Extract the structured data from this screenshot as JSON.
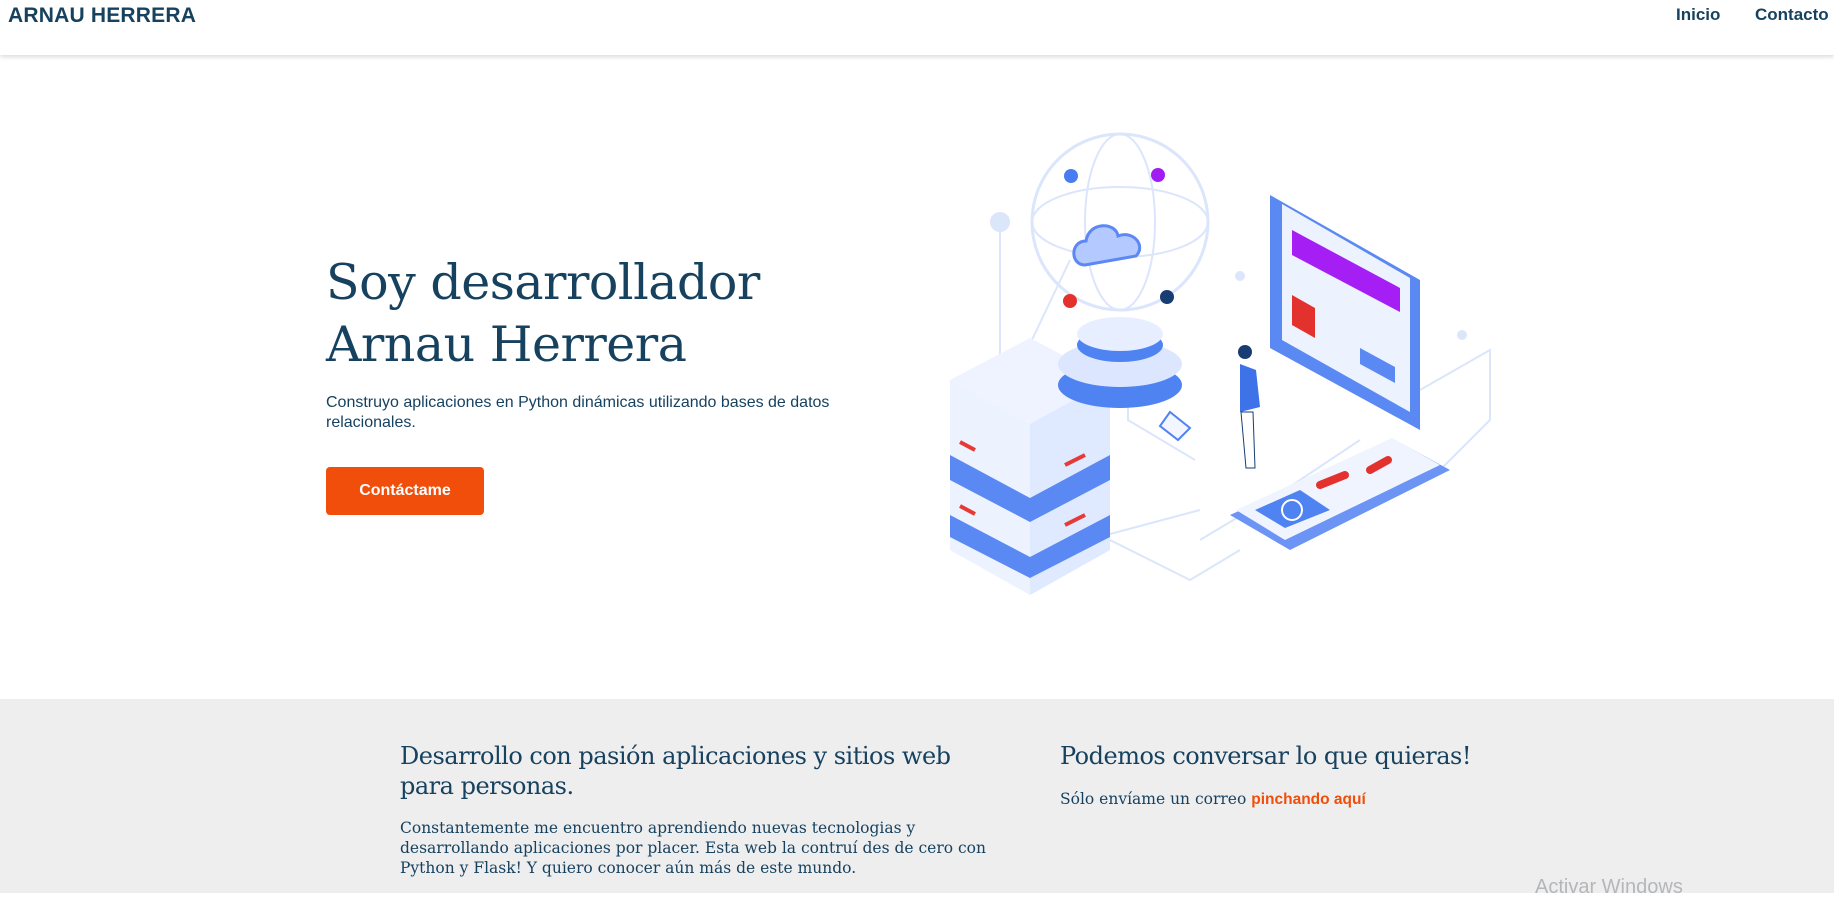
{
  "nav": {
    "brand": "ARNAU HERRERA",
    "links": [
      "Inicio",
      "Contacto"
    ]
  },
  "hero": {
    "title_line1": "Soy desarrollador",
    "title_line2": "Arnau Herrera",
    "text": "Construyo aplicaciones en Python dinámicas utilizando bases de datos relacionales.",
    "cta_label": "Contáctame"
  },
  "features": {
    "left": {
      "title": "Desarrollo con pasión aplicaciones y sitios web para personas.",
      "text": "Constantemente me encuentro aprendiendo nuevas tecnologias y desarrollando aplicaciones por placer. Esta web la contruí des de cero con Python y Flask! Y quiero conocer aún más de este mundo."
    },
    "right": {
      "title": "Podemos conversar lo que quieras!",
      "text_prefix": "Sólo envíame un correo",
      "link_label": "pinchando aquí"
    }
  },
  "overlay": {
    "watermark": "Activar Windows"
  },
  "colors": {
    "primary": "#17425f",
    "accent": "#f04e0a",
    "band": "#eeeeef"
  }
}
